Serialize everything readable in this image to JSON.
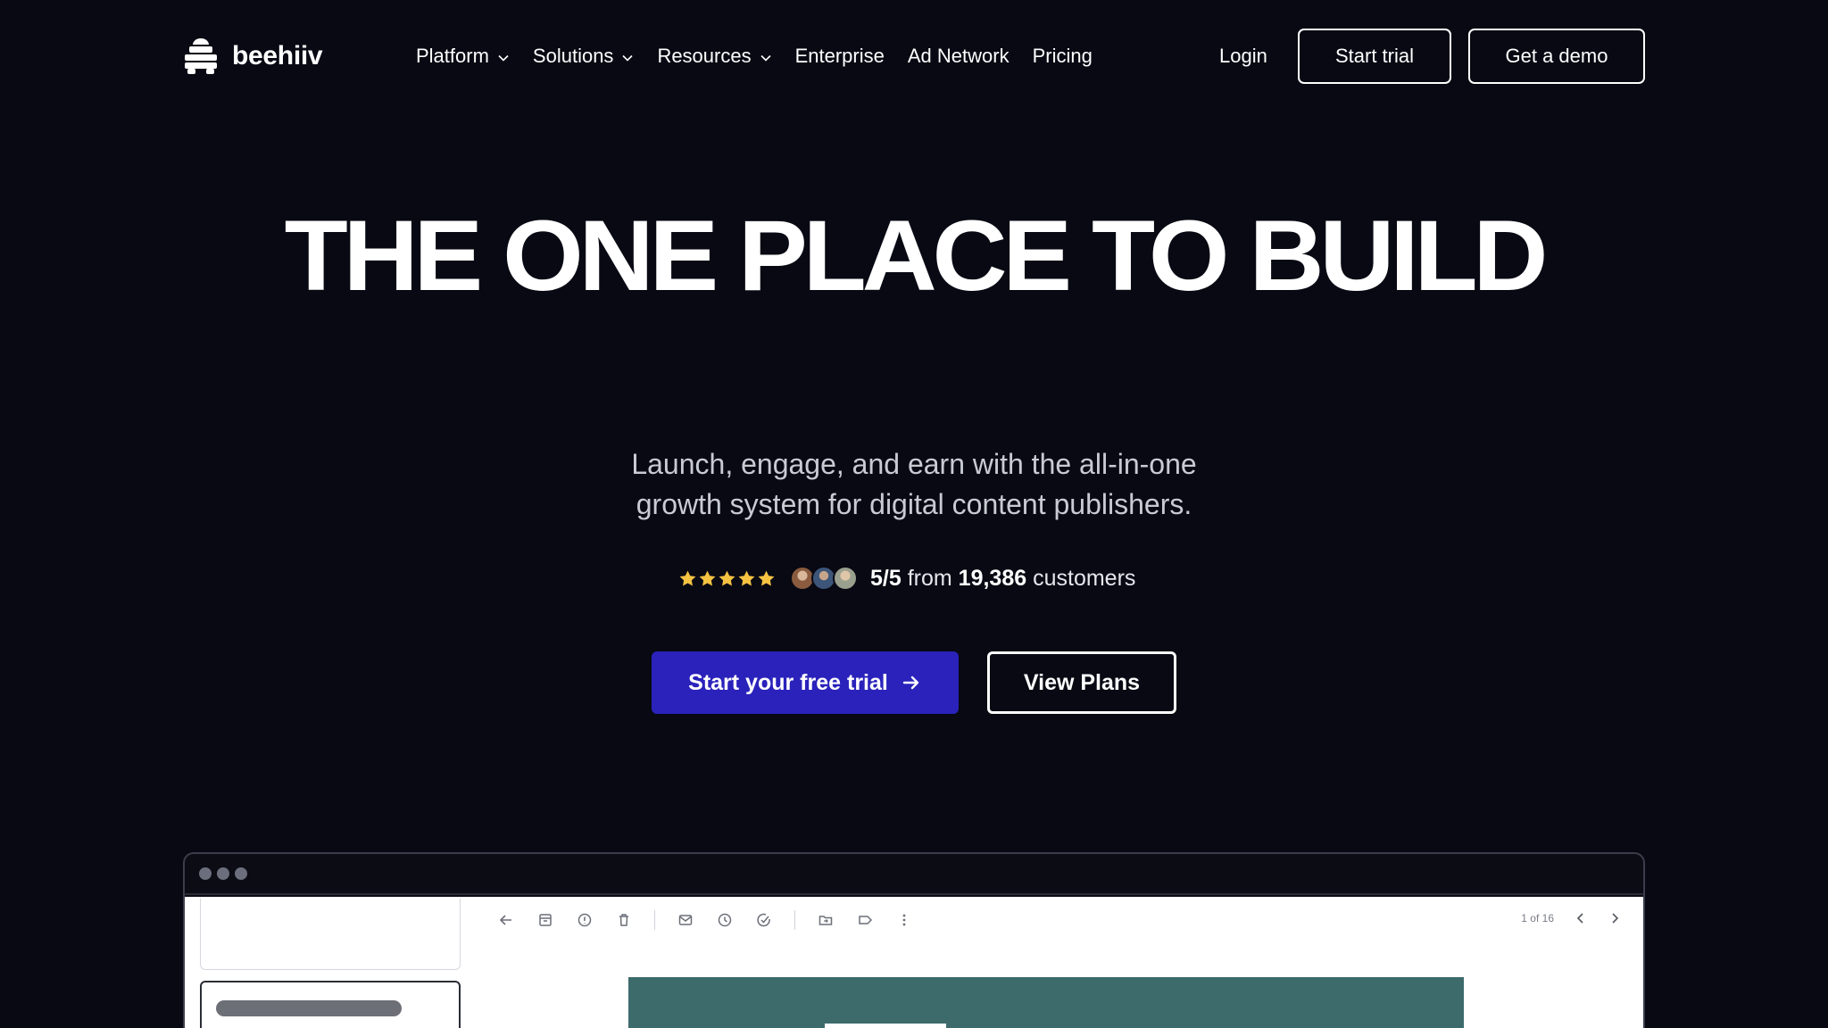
{
  "brand": {
    "name": "beehiiv"
  },
  "nav": {
    "links": [
      {
        "label": "Platform",
        "dropdown": true
      },
      {
        "label": "Solutions",
        "dropdown": true
      },
      {
        "label": "Resources",
        "dropdown": true
      },
      {
        "label": "Enterprise",
        "dropdown": false
      },
      {
        "label": "Ad Network",
        "dropdown": false
      },
      {
        "label": "Pricing",
        "dropdown": false
      }
    ],
    "login": "Login",
    "start_trial": "Start trial",
    "get_demo": "Get a demo"
  },
  "hero": {
    "title": "THE ONE PLACE TO BUILD",
    "subtitle_line1": "Launch, engage, and earn with the all-in-one",
    "subtitle_line2": "growth system for digital content publishers.",
    "rating": {
      "stars": 5,
      "score": "5/5",
      "from": "from",
      "count": "19,386",
      "suffix": "customers"
    },
    "cta_primary": "Start your free trial",
    "cta_secondary": "View Plans"
  },
  "preview": {
    "pager": "1 of 16"
  },
  "colors": {
    "background": "#080913",
    "primary_button": "#2a22bb",
    "star": "#f5c242",
    "preview_hero": "#3d6b6c"
  }
}
